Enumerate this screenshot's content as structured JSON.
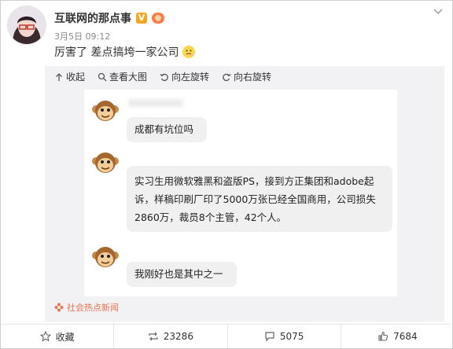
{
  "post": {
    "author": "互联网的那点事",
    "time": "3月5日 09:12",
    "text": "厉害了 差点搞垮一家公司"
  },
  "toolbar": {
    "collapse": "收起",
    "view_large": "查看大图",
    "rotate_left": "向左旋转",
    "rotate_right": "向右旋转"
  },
  "chat": {
    "messages": [
      {
        "line1": "成都有坑位吗"
      },
      {
        "line1": "实习生用微软雅黑和盗版PS，接到方正集团和adobe起",
        "line2": "诉，样稿印刷厂印了5000万张已经全国商用，公司损失",
        "line3": "2860万，裁员8个主管，42个人。"
      },
      {
        "line1": "我刚好也是其中之一"
      }
    ]
  },
  "source": "社会热点新闻",
  "actions": {
    "favorite": "收藏",
    "repost": "23286",
    "comment": "5075",
    "like": "7684"
  }
}
